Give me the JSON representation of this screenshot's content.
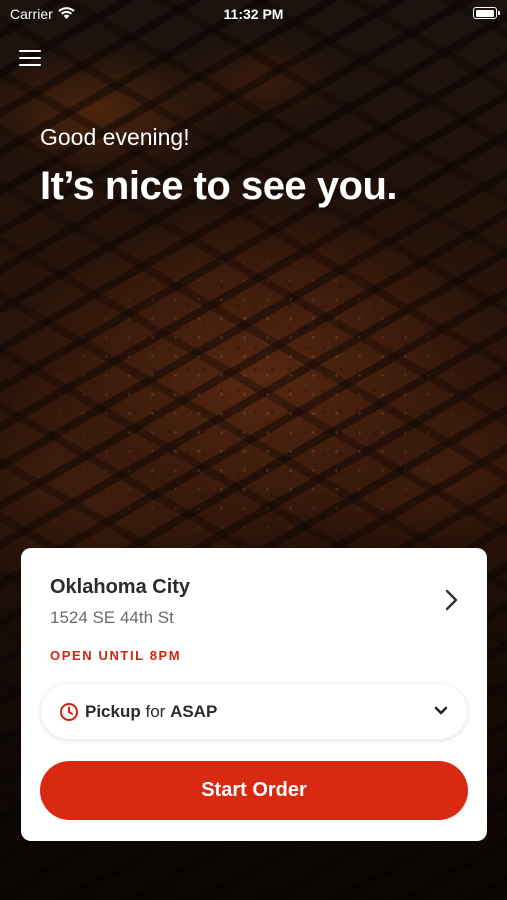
{
  "status_bar": {
    "carrier": "Carrier",
    "time": "11:32 PM",
    "wifi_icon": "wifi-icon",
    "battery_icon": "battery-icon",
    "battery_level": 1.0
  },
  "header": {
    "menu_icon": "hamburger-menu-icon",
    "greeting": "Good evening!",
    "headline": "It’s nice to see you."
  },
  "location_card": {
    "city": "Oklahoma City",
    "address": "1524 SE 44th St",
    "open_status": "OPEN UNTIL 8PM",
    "chevron_icon": "chevron-right-icon",
    "pickup": {
      "clock_icon": "clock-icon",
      "mode": "Pickup",
      "connector": "for",
      "time": "ASAP",
      "chevron_icon": "chevron-down-icon"
    },
    "start_order_label": "Start Order"
  },
  "colors": {
    "accent": "#d92a11",
    "open_status": "#d42311",
    "card_background": "#ffffff",
    "primary_text": "#2b2b2b",
    "secondary_text": "#6b6b6b"
  }
}
